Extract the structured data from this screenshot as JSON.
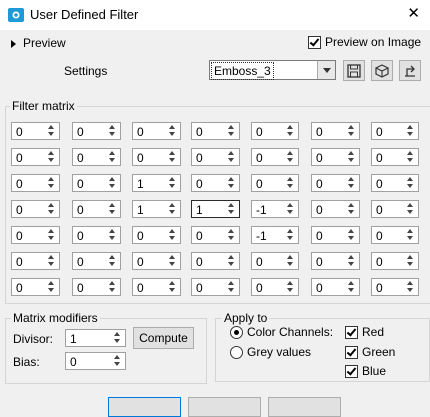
{
  "window": {
    "title": "User Defined Filter",
    "close_glyph": "✕"
  },
  "preview": {
    "label": "Preview",
    "on_image_label": "Preview on Image",
    "on_image_checked": true
  },
  "settings": {
    "label": "Settings",
    "selected": "Emboss_3",
    "icons": [
      "save-preset-icon",
      "load-preset-icon",
      "reset-icon"
    ]
  },
  "filter_matrix": {
    "label": "Filter matrix",
    "rows": [
      [
        "0",
        "0",
        "0",
        "0",
        "0",
        "0",
        "0"
      ],
      [
        "0",
        "0",
        "0",
        "0",
        "0",
        "0",
        "0"
      ],
      [
        "0",
        "0",
        "1",
        "0",
        "0",
        "0",
        "0"
      ],
      [
        "0",
        "0",
        "1",
        "1",
        "-1",
        "0",
        "0"
      ],
      [
        "0",
        "0",
        "0",
        "0",
        "-1",
        "0",
        "0"
      ],
      [
        "0",
        "0",
        "0",
        "0",
        "0",
        "0",
        "0"
      ],
      [
        "0",
        "0",
        "0",
        "0",
        "0",
        "0",
        "0"
      ]
    ]
  },
  "modifiers": {
    "label": "Matrix modifiers",
    "divisor_label": "Divisor:",
    "divisor": "1",
    "compute_label": "Compute",
    "bias_label": "Bias:",
    "bias": "0"
  },
  "apply_to": {
    "label": "Apply to",
    "color_channels_label": "Color Channels:",
    "color_channels_selected": true,
    "grey_values_label": "Grey values",
    "grey_values_selected": false,
    "red_label": "Red",
    "red": true,
    "green_label": "Green",
    "green": true,
    "blue_label": "Blue",
    "blue": true
  }
}
